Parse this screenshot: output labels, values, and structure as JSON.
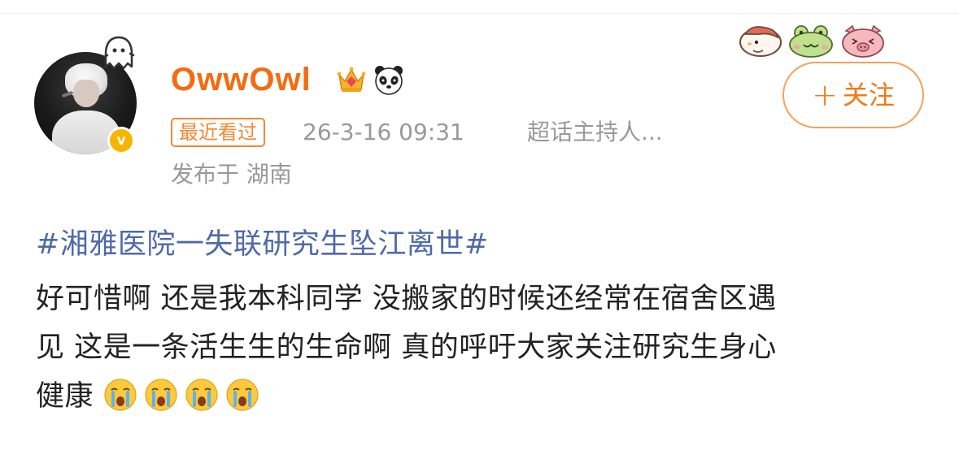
{
  "post": {
    "author": {
      "name": "OwwOwl",
      "avatar_icon": "avatar-photo",
      "badges": [
        "crown-icon",
        "panda-icon",
        "ghost-icon"
      ],
      "verified_icon": "verified-v-icon",
      "verified_text": "v"
    },
    "meta": {
      "recent_badge": "最近看过",
      "time": "26-3-16 09:31",
      "source": "超话主持人...",
      "location": "发布于 湖南"
    },
    "follow_button": {
      "icon": "plus-icon",
      "plus": "+",
      "label": "关注",
      "color": "#f07a1a"
    },
    "stickers": [
      "chick-sticker-icon",
      "frog-sticker-icon",
      "pig-sticker-icon"
    ],
    "hashtag": "#湘雅医院一失联研究生坠江离世#",
    "body_lines": [
      "好可惜啊 还是我本科同学 没搬家的时候还经常在宿舍区遇",
      "见 这是一条活生生的生命啊 真的呼吁大家关注研究生身心",
      "健康"
    ],
    "emoji_icons": [
      "crying-face-icon",
      "crying-face-icon",
      "crying-face-icon",
      "crying-face-icon"
    ],
    "colors": {
      "username": "#f56b0f",
      "hashtag": "#4e6aa8",
      "meta": "#999999"
    }
  }
}
